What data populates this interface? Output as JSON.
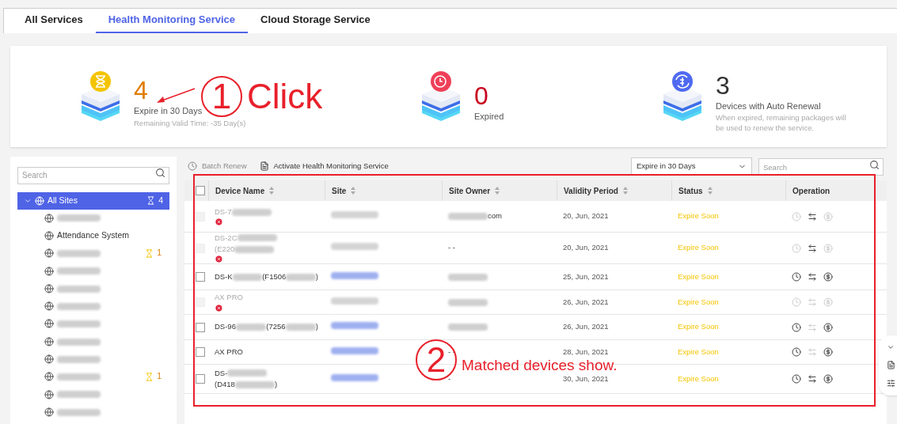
{
  "tabs": [
    {
      "label": "All Services",
      "selected": false
    },
    {
      "label": "Health Monitoring Service",
      "selected": true
    },
    {
      "label": "Cloud Storage Service",
      "selected": false
    }
  ],
  "summary": [
    {
      "kind": "expiring",
      "value": "4",
      "label": "Expire in 30 Days",
      "note": "Remaining Valid Time: -35 Day(s)"
    },
    {
      "kind": "expired",
      "value": "0",
      "label": "Expired"
    },
    {
      "kind": "renewal",
      "value": "3",
      "label": "Devices with Auto Renewal",
      "note": "When expired, remaining packages will be used to renew the service."
    }
  ],
  "sidebar": {
    "search": {
      "placeholder": "Search"
    },
    "tree": [
      {
        "name": "All Sites",
        "count": "4",
        "selected": true,
        "expanded": true,
        "children": [
          {
            "kind": "blurred"
          },
          {
            "kind": "named",
            "name": "Attendance System"
          },
          {
            "kind": "blurred",
            "count": "1"
          },
          {
            "kind": "blurred"
          },
          {
            "kind": "blurred"
          },
          {
            "kind": "blurred"
          },
          {
            "kind": "blurred"
          },
          {
            "kind": "blurred"
          },
          {
            "kind": "blurred"
          },
          {
            "kind": "blurred",
            "count": "1"
          },
          {
            "kind": "blurred"
          },
          {
            "kind": "blurred"
          }
        ]
      }
    ]
  },
  "toolbar": {
    "buttons": [
      {
        "label": "Batch Renew",
        "disabled": true
      },
      {
        "label": "Activate Health Monitoring Service",
        "disabled": false
      }
    ],
    "filter": {
      "value": "Expire in 30 Days"
    },
    "search": {
      "placeholder": "Search"
    }
  },
  "table": {
    "all_checked": false,
    "columns": [
      {
        "label": "Device Name",
        "sortable": true
      },
      {
        "label": "Site",
        "sortable": true
      },
      {
        "label": "Site Owner",
        "sortable": true
      },
      {
        "label": "Validity Period",
        "sortable": true
      },
      {
        "label": "Status",
        "sortable": true
      },
      {
        "label": "Operation",
        "sortable": false
      }
    ],
    "rows": [
      {
        "disabled": true,
        "error": true,
        "device": [
          {
            "kind": "text",
            "text": "DS-7"
          },
          {
            "kind": "blur"
          },
          {
            "kind": "break"
          }
        ],
        "site_link": false,
        "owner": [
          {
            "kind": "blur"
          },
          {
            "kind": "text",
            "text": "com"
          }
        ],
        "validity": "20, Jun, 2021",
        "status": "Expire Soon",
        "ops": [
          false,
          true,
          false
        ]
      },
      {
        "disabled": true,
        "error": true,
        "device": [
          {
            "kind": "text",
            "text": "DS-2C"
          },
          {
            "kind": "blur"
          },
          {
            "kind": "break"
          },
          {
            "kind": "text",
            "text": "(E220"
          },
          {
            "kind": "blur"
          }
        ],
        "site_link": false,
        "owner": [
          {
            "kind": "text",
            "text": "- -"
          }
        ],
        "validity": "20, Jun, 2021",
        "status": "Expire Soon",
        "ops": [
          false,
          true,
          false
        ]
      },
      {
        "disabled": false,
        "error": false,
        "device": [
          {
            "kind": "text",
            "text": "DS-K"
          },
          {
            "kind": "blur"
          },
          {
            "kind": "text",
            "text": "(F1506"
          },
          {
            "kind": "blur"
          },
          {
            "kind": "text",
            "text": ")"
          }
        ],
        "site_link": true,
        "owner": [
          {
            "kind": "blur"
          }
        ],
        "validity": "25, Jun, 2021",
        "status": "Expire Soon",
        "ops": [
          true,
          true,
          true
        ]
      },
      {
        "disabled": true,
        "error": true,
        "device": [
          {
            "kind": "text",
            "text": "AX PRO"
          }
        ],
        "site_link": false,
        "owner": [
          {
            "kind": "blur"
          }
        ],
        "validity": "26, Jun, 2021",
        "status": "Expire Soon",
        "ops": [
          false,
          false,
          false
        ]
      },
      {
        "disabled": false,
        "error": false,
        "device": [
          {
            "kind": "text",
            "text": "DS-96"
          },
          {
            "kind": "blur"
          },
          {
            "kind": "text",
            "text": "(7256"
          },
          {
            "kind": "blur"
          },
          {
            "kind": "text",
            "text": ")"
          }
        ],
        "site_link": true,
        "owner": [
          {
            "kind": "blur"
          }
        ],
        "validity": "26, Jun, 2021",
        "status": "Expire Soon",
        "ops": [
          true,
          false,
          true
        ]
      },
      {
        "disabled": false,
        "error": false,
        "device": [
          {
            "kind": "text",
            "text": "AX PRO"
          }
        ],
        "site_link": true,
        "owner": [
          {
            "kind": "text",
            "text": "- -"
          }
        ],
        "validity": "28, Jun, 2021",
        "status": "Expire Soon",
        "ops": [
          true,
          false,
          true
        ]
      },
      {
        "disabled": false,
        "error": false,
        "device": [
          {
            "kind": "text",
            "text": "DS-"
          },
          {
            "kind": "blur"
          },
          {
            "kind": "break"
          },
          {
            "kind": "text",
            "text": "(D418"
          },
          {
            "kind": "blur"
          },
          {
            "kind": "text",
            "text": ")"
          }
        ],
        "site_link": true,
        "owner": [
          {
            "kind": "text",
            "text": "-"
          }
        ],
        "validity": "30, Jun, 2021",
        "status": "Expire Soon",
        "ops": [
          true,
          true,
          true
        ]
      }
    ]
  },
  "annotations": [
    {
      "number": "1",
      "text": "Click"
    },
    {
      "number": "2",
      "text": "Matched devices show."
    }
  ]
}
